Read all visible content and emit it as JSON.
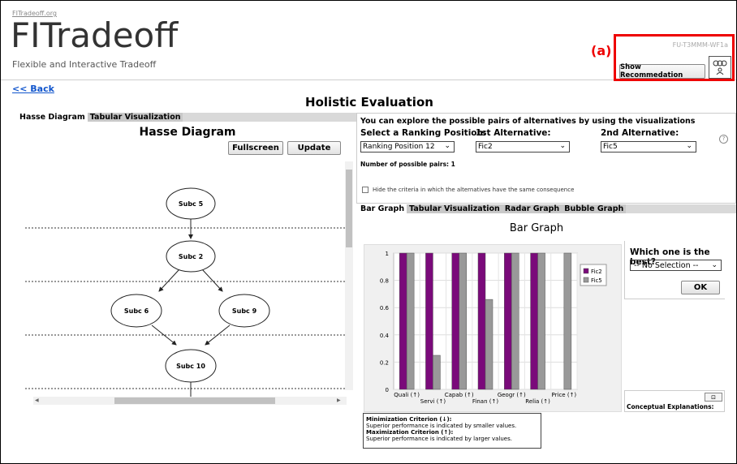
{
  "header": {
    "logo_small": "FITradeoff.org",
    "logo_main": "FITradeoff",
    "logo_sub": "Flexible and Interactive Tradeoff",
    "version": "FU-T3MMM-WF1a",
    "annotation_label": "(a)",
    "show_recommendation": "Show Recommedation"
  },
  "nav": {
    "back": "<< Back"
  },
  "page_title": "Holistic Evaluation",
  "left": {
    "tabs": [
      "Hasse Diagram",
      "Tabular Visualization"
    ],
    "title": "Hasse Diagram",
    "fullscreen": "Fullscreen",
    "update": "Update",
    "nodes": [
      "Subc 5",
      "Subc 2",
      "Subc 6",
      "Subc 9",
      "Subc 10"
    ]
  },
  "right": {
    "heading": "You can explore the possible pairs of alternatives by using the visualizations",
    "rank_label": "Select a Ranking Position:",
    "alt1_label": "1st Alternative:",
    "alt2_label": "2nd Alternative:",
    "rank_value": "Ranking Position 12",
    "alt1_value": "Fic2",
    "alt2_value": "Fic5",
    "help": "?",
    "num_pairs": "Number of possible pairs:  1",
    "hide_criteria": "Hide the criteria in which the alternatives have the same consequence",
    "tabs": [
      "Bar Graph",
      "Tabular Visualization",
      "Radar Graph",
      "Bubble Graph"
    ],
    "graph_title": "Bar Graph",
    "best_title": "Which one is the best?",
    "best_value": "-- No Selection --",
    "ok": "OK",
    "concept": "Conceptual Explanations:",
    "legend_text": {
      "min_title": "Minimization Criterion (↓):",
      "min_desc": "Superior performance is indicated by smaller values.",
      "max_title": "Maximization Criterion (↑):",
      "max_desc": "Superior performance is indicated by larger values."
    }
  },
  "colors": {
    "fic2": "#7a0a7a",
    "fic5": "#999999",
    "highlight": "#ee0000",
    "link": "#1155cc"
  },
  "chart_data": {
    "type": "bar",
    "categories": [
      "Quali (↑)",
      "Servi (↑)",
      "Capab (↑)",
      "Finan (↑)",
      "Geogr (↑)",
      "Relia (↑)",
      "Price (↑)"
    ],
    "series": [
      {
        "name": "Fic2",
        "values": [
          1,
          1,
          1,
          1,
          1,
          1,
          0
        ]
      },
      {
        "name": "Fic5",
        "values": [
          1,
          0.25,
          1,
          0.66,
          1,
          1,
          1
        ]
      }
    ],
    "ylim": [
      0,
      1
    ],
    "yticks": [
      "0",
      "0.2",
      "0.4",
      "0.6",
      "0.8",
      "1"
    ],
    "grid": true,
    "legend": "right"
  }
}
